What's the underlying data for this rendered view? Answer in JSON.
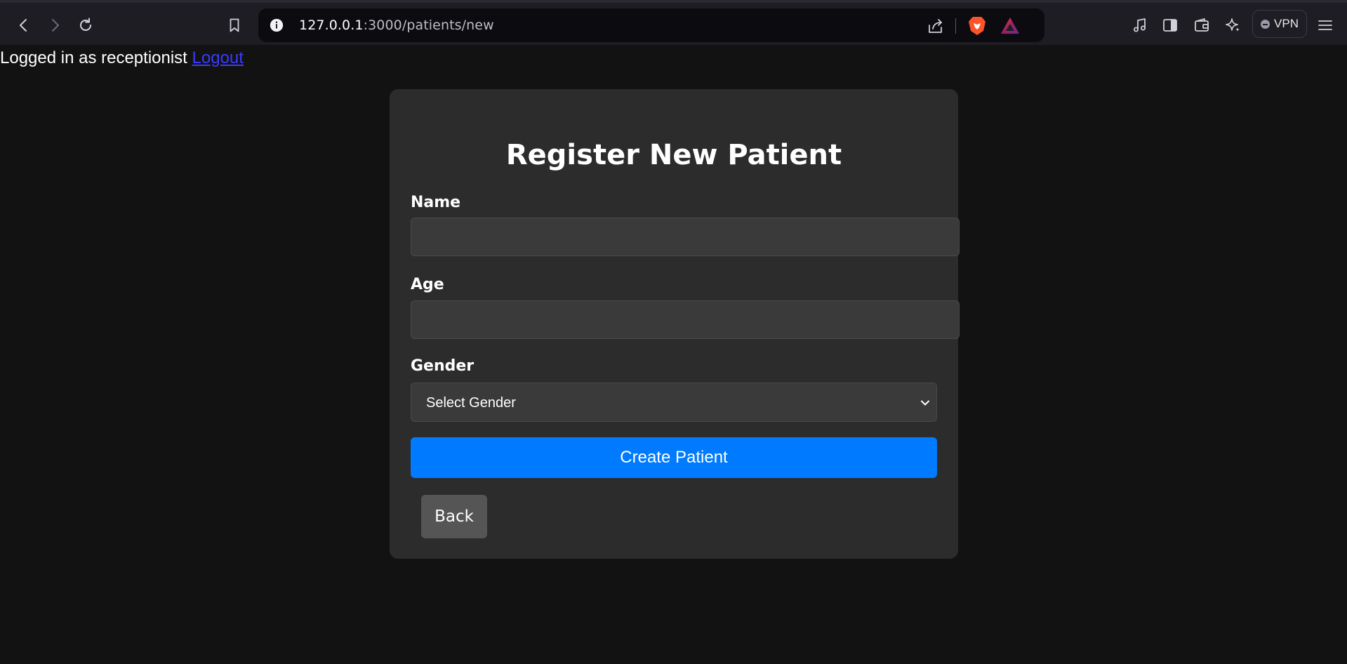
{
  "browser": {
    "url_host": "127.0.0.1",
    "url_path": ":3000/patients/new",
    "vpn_label": "VPN",
    "icons": [
      "back-icon",
      "forward-icon",
      "reload-icon",
      "bookmark-icon",
      "site-info-icon",
      "share-icon",
      "brave-shields-icon",
      "brave-rewards-icon",
      "media-icon",
      "sidebar-icon",
      "wallet-icon",
      "leo-ai-icon",
      "vpn-icon",
      "menu-icon"
    ]
  },
  "session": {
    "text": "Logged in as receptionist",
    "logout_label": "Logout"
  },
  "form": {
    "title": "Register New Patient",
    "name_label": "Name",
    "name_value": "",
    "age_label": "Age",
    "age_value": "",
    "gender_label": "Gender",
    "gender_selected": "Select Gender",
    "submit_label": "Create Patient",
    "back_label": "Back"
  },
  "colors": {
    "page_bg": "#121212",
    "card_bg": "#2c2c2c",
    "primary": "#007bff",
    "secondary": "#555555"
  }
}
